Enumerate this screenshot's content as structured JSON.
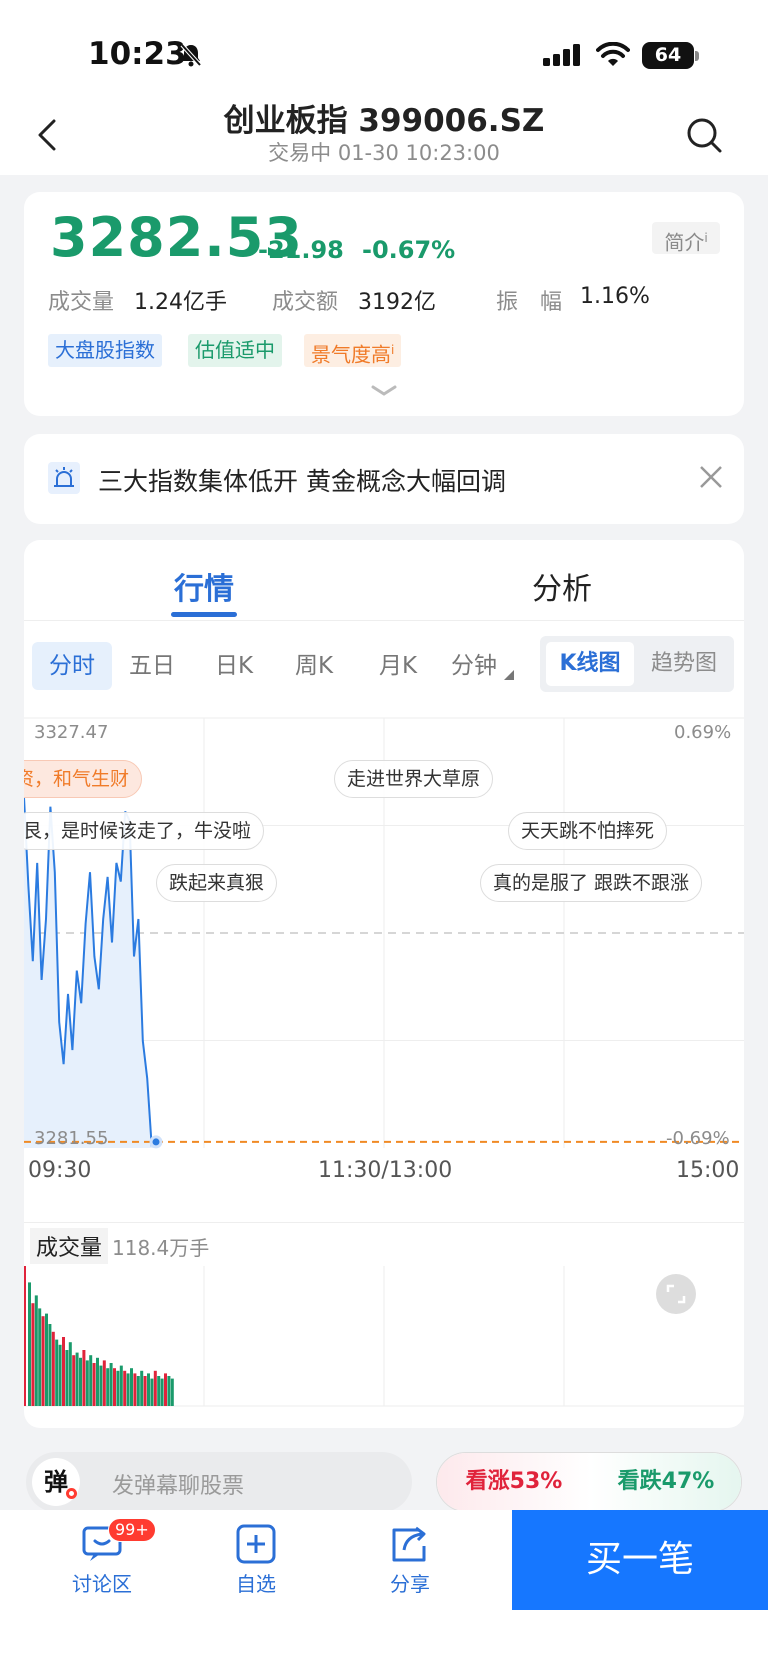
{
  "status": {
    "time": "10:23",
    "battery": "64"
  },
  "nav": {
    "title": "创业板指 399006.SZ",
    "subtitle": "交易中 01-30 10:23:00"
  },
  "quote": {
    "price": "3282.53",
    "change": "-21.98",
    "change_pct": "-0.67%",
    "intro_label": "简介",
    "volume_label": "成交量",
    "volume": "1.24亿手",
    "amount_label": "成交额",
    "amount": "3192亿",
    "amplitude_label": "振　幅",
    "amplitude": "1.16%",
    "tags": [
      "大盘股指数",
      "估值适中",
      "景气度高"
    ]
  },
  "news": {
    "text": "三大指数集体低开 黄金概念大幅回调"
  },
  "chart_tabs": {
    "market": "行情",
    "analysis": "分析"
  },
  "periods": [
    "分时",
    "五日",
    "日K",
    "周K",
    "月K",
    "分钟"
  ],
  "modes": {
    "kline": "K线图",
    "trend": "趋势图"
  },
  "chart_labels": {
    "y_top": "3327.47",
    "y_bottom": "3281.55",
    "pct_top": "0.69%",
    "pct_bottom": "-0.69%",
    "t_start": "09:30",
    "t_mid": "11:30/13:00",
    "t_end": "15:00"
  },
  "danmu": [
    "资，和气生财",
    "走进世界大草原",
    "艮，是时候该走了，牛没啦",
    "天天跳不怕摔死",
    "跌起来真狠",
    "真的是服了 跟跌不跟涨"
  ],
  "volume_panel": {
    "title": "成交量",
    "value": "118.4万手"
  },
  "chart_data": {
    "type": "line",
    "x": [
      "09:30",
      "11:30/13:00",
      "15:00"
    ],
    "ylim": [
      3281.55,
      3327.47
    ],
    "y_pct_range": [
      "-0.69%",
      "0.69%"
    ],
    "series": [
      {
        "values": [
          3319.0,
          3309.5,
          3301.5,
          3312.0,
          3299.5,
          3306.0,
          3318.0,
          3311.0,
          3295.0,
          3290.5,
          3298.0,
          3292.0,
          3300.5,
          3297.0,
          3305.5,
          3311.0,
          3302.0,
          3298.5,
          3306.0,
          3310.5,
          3303.5,
          3312.0,
          3310.0,
          3317.5,
          3316.5,
          3302.0,
          3306.0,
          3293.0,
          3289.0,
          3281.9,
          3282.2
        ]
      }
    ],
    "volume": [
      46,
      38,
      41,
      36,
      33,
      34,
      30,
      27,
      24,
      22,
      25,
      20,
      23,
      18,
      19,
      17,
      20,
      16,
      18,
      15,
      17,
      14,
      16,
      13,
      15,
      13,
      12,
      14,
      12,
      11,
      13,
      11,
      10,
      12,
      10,
      11,
      9,
      12,
      10,
      9,
      11,
      10,
      9
    ]
  },
  "bottom": {
    "danmu_badge": "弹",
    "danmu_placeholder": "发弹幕聊股票",
    "vote_up": "看涨53%",
    "vote_down": "看跌47%"
  },
  "tabbar": {
    "discuss": "讨论区",
    "discuss_badge": "99+",
    "watch": "自选",
    "share": "分享",
    "buy": "买一笔"
  },
  "colors": {
    "down": "#1a9a6b",
    "up": "#e0233b",
    "accent": "#2b6fd6",
    "buy": "#1677ff"
  }
}
